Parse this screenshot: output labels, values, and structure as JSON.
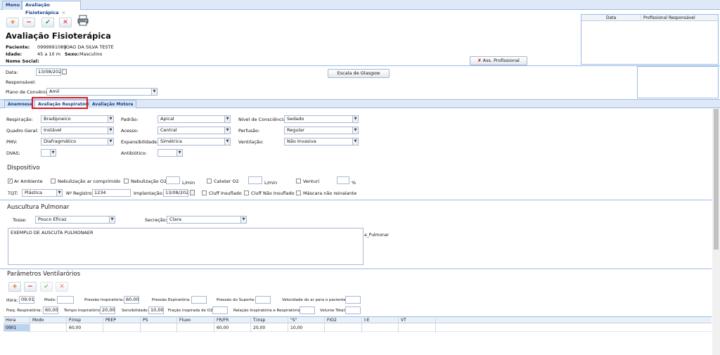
{
  "tabs": {
    "menu": "Menu",
    "current": "Avaliação Fisioterápica",
    "close": "×"
  },
  "toolbar": {
    "add": "+",
    "remove": "−",
    "confirm": "✔",
    "cancel": "✕"
  },
  "header": {
    "title": "Avaliação Fisioterápica",
    "patient_label": "Paciente:",
    "patient_id": "0999991089",
    "patient_name": "JOAO DA SILVA TESTE",
    "age_label": "Idade:",
    "age_value": "45 a 10 m",
    "sex_label": "Sexo:",
    "sex_value": "Masculino",
    "social_label": "Nome Social:",
    "ass_button": "Ass. Profissional"
  },
  "history_table": {
    "col_date": "Data",
    "col_professional": "Profissional Responsável"
  },
  "form": {
    "date_label": "Data:",
    "date_value": "13/08/202",
    "responsible_label": "Responsável:",
    "plan_label": "Plano de Convênio:",
    "plan_value": "Amil",
    "glasgow_button": "Escala de Glasgow"
  },
  "subtabs": {
    "anamnese": "Anamnese",
    "respiratoria": "Avaliação Respiratória",
    "motora": "Avaliação Motora"
  },
  "fields": {
    "respiracao_label": "Respiração:",
    "respiracao_value": "Bradipneico",
    "padrao_label": "Padrão:",
    "padrao_value": "Apical",
    "consciencia_label": "Nível de Consciência:",
    "consciencia_value": "Sedado",
    "quadro_label": "Quadro Geral:",
    "quadro_value": "Instável",
    "acesso_label": "Acesso:",
    "acesso_value": "Central",
    "perfusao_label": "Perfusão:",
    "perfusao_value": "Regular",
    "pmv_label": "PMV:",
    "pmv_value": "Diafragmático",
    "expans_label": "Expansibilidade:",
    "expans_value": "Simétrica",
    "ventilacao_label": "Ventilação:",
    "ventilacao_value": "Não Invasiva",
    "dvas_label": "DVAS:",
    "dvas_value": "",
    "antibiotico_label": "Antibiótico:",
    "antibiotico_value": ""
  },
  "dispositivo": {
    "title": "Dispositivo",
    "ar_ambiente": "Ar Ambiente",
    "nebul_ar": "Nebulização ar comprimido",
    "nebul_o2": "Nebulização O2",
    "lmin1": "L/min",
    "cateter": "Cateter O2",
    "lmin2": "L/min",
    "venturi": "Venturi",
    "pct": "%",
    "tqt_label": "TQT:",
    "tqt_value": "Plástica",
    "registro_label": "Nº Registro:",
    "registro_value": "1234",
    "implantacao_label": "Implantação:",
    "implantacao_value": "13/08/202",
    "cluff_insuflado": "Cluff Insuflado",
    "cluff_nao": "Cluff Não Insuflado",
    "mascara": "Máscara não reinalante"
  },
  "ausculta": {
    "title": "Auscultura Pulmonar",
    "tosse_label": "Tosse:",
    "tosse_value": "Pouco Eficaz",
    "secrecao_label": "Secreção:",
    "secrecao_value": "Clara",
    "text": "EXEMPLO DE AUSCUTA PULMONAER",
    "side_label": "a_Pulmonar"
  },
  "parametros": {
    "title": "Parâmetros Ventilarórios",
    "hora_label": "Hora:",
    "hora_value": "09:01",
    "modo_label": "Modo:",
    "pinsp_label": "Pressão Inspiratória:",
    "pinsp_value": "60,00",
    "pexp_label": "Pressão Expiratória:",
    "psup_label": "Pressão do Suporte:",
    "vel_label": "Velocidade do ar para o paciente:",
    "freq_label": "Freq. Respiratória:",
    "freq_value": "60,00",
    "tinsp_label": "Tempo Inspiratório:",
    "tinsp_value": "20,00",
    "sens_label": "Sensibilidade:",
    "sens_value": "10,00",
    "fio2_label": "Fração inspirada de O2:",
    "rel_label": "Relação Inspiratória e Respiratória:",
    "vol_label": "Volume Total:"
  },
  "grid": {
    "headers": [
      "Hora",
      "Modo",
      "P.Insp",
      "PEEP",
      "PS",
      "Fluxo",
      "FR/FR",
      "T.Insp",
      "\"S\"",
      "FIO2",
      "I:E",
      "VT"
    ],
    "row": [
      "0901",
      "",
      "60,00",
      "",
      "",
      "",
      "60,00",
      "20,00",
      "10,00",
      "",
      "",
      ""
    ]
  },
  "colors": {
    "accent": "#99bbe8",
    "highlight": "#e0141e"
  }
}
